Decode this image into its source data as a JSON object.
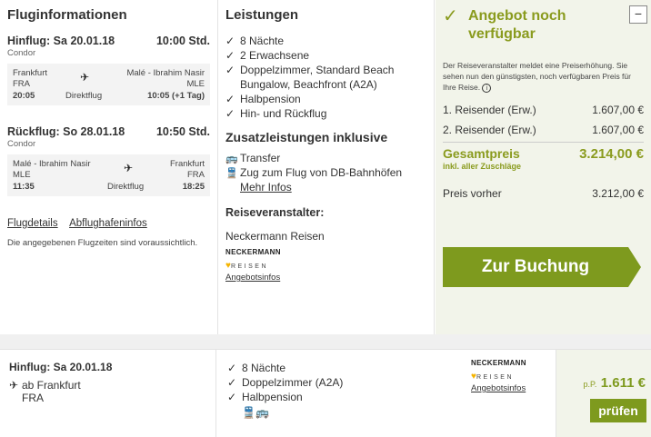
{
  "flight": {
    "title": "Fluginformationen",
    "outbound": {
      "label": "Hinflug: Sa 20.01.18",
      "time": "10:00 Std.",
      "carrier": "Condor",
      "from_city": "Frankfurt",
      "from_code": "FRA",
      "dep_time": "20:05",
      "type": "Direktflug",
      "to_city": "Malé - Ibrahim Nasir",
      "to_code": "MLE",
      "arr_time": "10:05 (+1 Tag)"
    },
    "return": {
      "label": "Rückflug: So 28.01.18",
      "time": "10:50 Std.",
      "carrier": "Condor",
      "from_city": "Malé - Ibrahim Nasir",
      "from_code": "MLE",
      "dep_time": "11:35",
      "type": "Direktflug",
      "to_city": "Frankfurt",
      "to_code": "FRA",
      "arr_time": "18:25"
    },
    "link_details": "Flugdetails",
    "link_airport": "Abflughafeninfos",
    "note": "Die angegebenen Flugzeiten sind voraussichtlich."
  },
  "services": {
    "title": "Leistungen",
    "items": [
      "8 Nächte",
      "2 Erwachsene",
      "Doppelzimmer, Standard Beach Bungalow, Beachfront (A2A)",
      "Halbpension",
      "Hin- und Rückflug"
    ],
    "extras_title": "Zusatzleistungen inklusive",
    "extra_transfer": "Transfer",
    "extra_train": "Zug zum Flug von DB-Bahnhöfen",
    "more_info": "Mehr Infos",
    "operator_title": "Reiseveranstalter:",
    "operator_name": "Neckermann Reisen",
    "logo_top": "NECKERMANN",
    "logo_bottom": "REISEN",
    "offer_info": "Angebotsinfos"
  },
  "price": {
    "status": "Angebot noch verfügbar",
    "note": "Der Reiseveranstalter meldet eine Preiserhöhung. Sie sehen nun den günstigsten, noch verfügbaren Preis für Ihre Reise.",
    "rows": [
      {
        "label": "1. Reisender (Erw.)",
        "value": "1.607,00 €"
      },
      {
        "label": "2. Reisender (Erw.)",
        "value": "1.607,00 €"
      }
    ],
    "total_label": "Gesamtpreis",
    "total_value": "3.214,00 €",
    "total_sub": "inkl. aller Zuschläge",
    "before_label": "Preis vorher",
    "before_value": "3.212,00 €",
    "book_button": "Zur Buchung",
    "collapse": "−"
  },
  "offer2": {
    "label": "Hinflug: Sa 20.01.18",
    "from": "ab Frankfurt",
    "code": "FRA",
    "items": [
      "8 Nächte",
      "Doppelzimmer (A2A)",
      "Halbpension"
    ],
    "logo_top": "NECKERMANN",
    "logo_bottom": "REISEN",
    "offer_info": "Angebotsinfos",
    "pp": "p.P.",
    "price": "1.611 €",
    "button": "prüfen"
  },
  "colors": {
    "accent": "#7e9a1e",
    "accent_text": "#8a9b1e",
    "panel": "#f2f4ea"
  }
}
